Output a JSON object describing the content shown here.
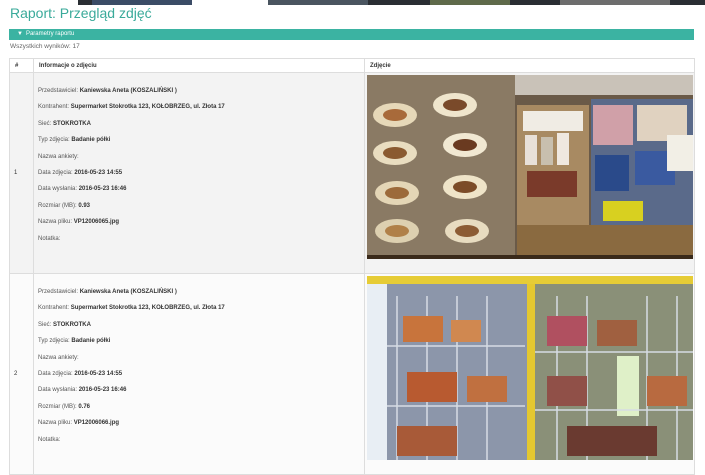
{
  "page": {
    "title": "Raport: Przegląd zdjęć"
  },
  "params": {
    "label": "Parametry raportu",
    "icon": "filter-icon"
  },
  "results": {
    "count_text": "Wszystkich wyników: 17"
  },
  "table": {
    "headers": [
      "#",
      "Informacje o zdjęciu",
      "Zdjęcie"
    ],
    "rows": [
      {
        "num": "1",
        "fields": [
          {
            "label": "Przedstawiciel:",
            "value": "Kaniewska Aneta (KOSZALIŃSKI )"
          },
          {
            "label": "Kontrahent:",
            "value": "Supermarket Stokrotka 123, KOŁOBRZEG, ul. Złota 17"
          },
          {
            "label": "Sieć:",
            "value": "STOKROTKA"
          },
          {
            "label": "Typ zdjęcia:",
            "value": "Badanie półki"
          },
          {
            "label": "Nazwa ankiety:",
            "value": ""
          },
          {
            "label": "Data zdjęcia:",
            "value": "2016-05-23 14:55"
          },
          {
            "label": "Data wysłania:",
            "value": "2016-05-23 16:46"
          },
          {
            "label": "Rozmiar (MB):",
            "value": "0.93"
          },
          {
            "label": "Nazwa pliku:",
            "value": "VP12006065.jpg"
          },
          {
            "label": "Notatka:",
            "value": ""
          }
        ]
      },
      {
        "num": "2",
        "fields": [
          {
            "label": "Przedstawiciel:",
            "value": "Kaniewska Aneta (KOSZALIŃSKI )"
          },
          {
            "label": "Kontrahent:",
            "value": "Supermarket Stokrotka 123, KOŁOBRZEG, ul. Złota 17"
          },
          {
            "label": "Sieć:",
            "value": "STOKROTKA"
          },
          {
            "label": "Typ zdjęcia:",
            "value": "Badanie półki"
          },
          {
            "label": "Nazwa ankiety:",
            "value": ""
          },
          {
            "label": "Data zdjęcia:",
            "value": "2016-05-23 14:55"
          },
          {
            "label": "Data wysłania:",
            "value": "2016-05-23 16:46"
          },
          {
            "label": "Rozmiar (MB):",
            "value": "0.76"
          },
          {
            "label": "Nazwa pliku:",
            "value": "VP12006066.jpg"
          },
          {
            "label": "Notatka:",
            "value": ""
          }
        ]
      }
    ]
  },
  "colors": {
    "accent": "#3bb3a2",
    "title": "#3aaa9a"
  }
}
